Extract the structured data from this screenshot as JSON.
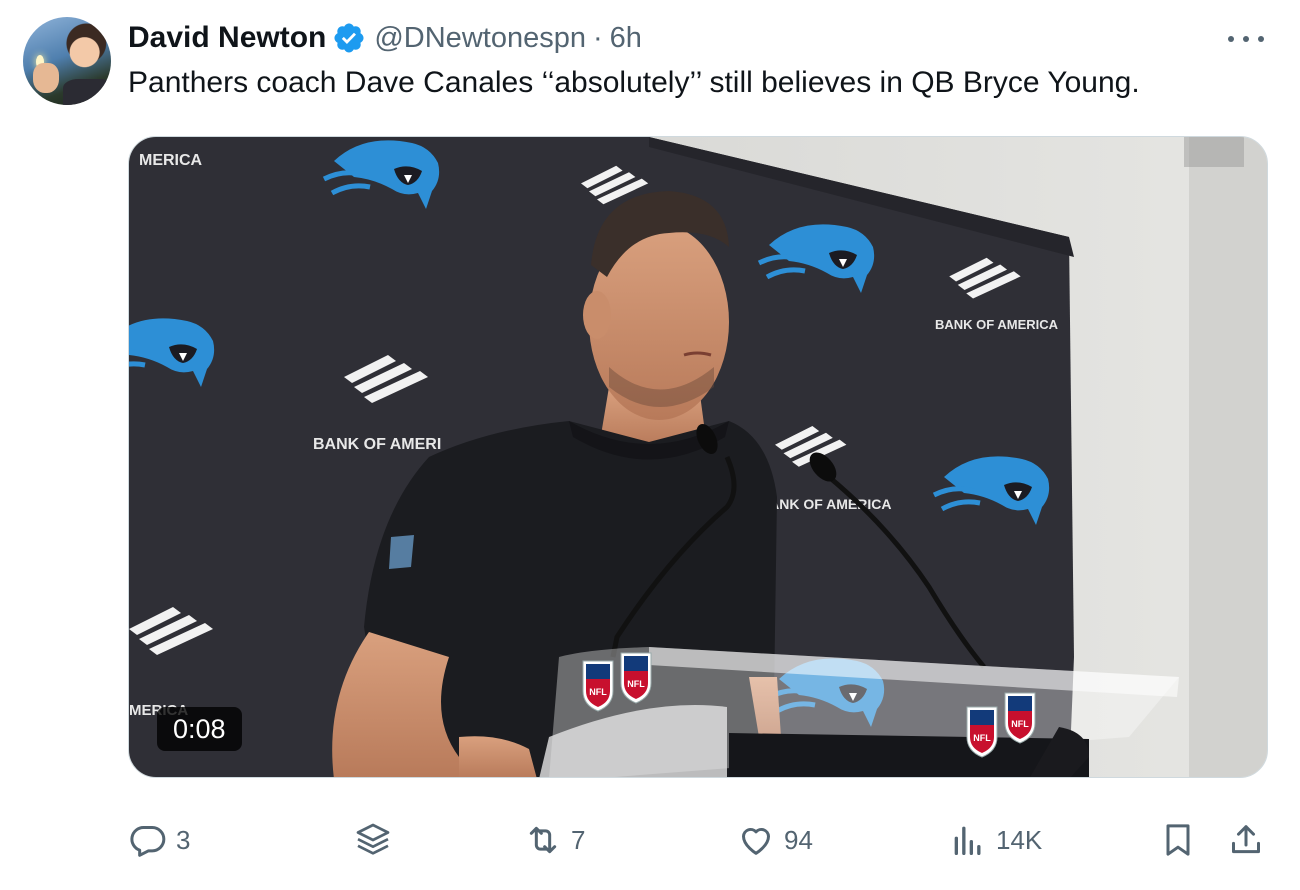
{
  "author": {
    "name": "David Newton",
    "handle": "@DNewtonespn",
    "separator": "·",
    "time": "6h",
    "verified": true
  },
  "tweet": {
    "text": "Panthers coach Dave Canales ‘‘absolutely’’ still believes in QB Bryce Young."
  },
  "media": {
    "duration": "0:08",
    "backdrop_text": [
      "MERICA",
      "BANK OF AMERICA",
      "BANK OF AMERI",
      "BANK OF AMERICA",
      "MERICA"
    ]
  },
  "actions": {
    "replies": "3",
    "reposts": "7",
    "likes": "94",
    "views": "14K"
  },
  "colors": {
    "text_primary": "#0f1419",
    "text_secondary": "#536471",
    "verified_blue": "#1d9bf0",
    "panther_blue": "#2d8fd6",
    "backdrop": "#2f2f36"
  }
}
